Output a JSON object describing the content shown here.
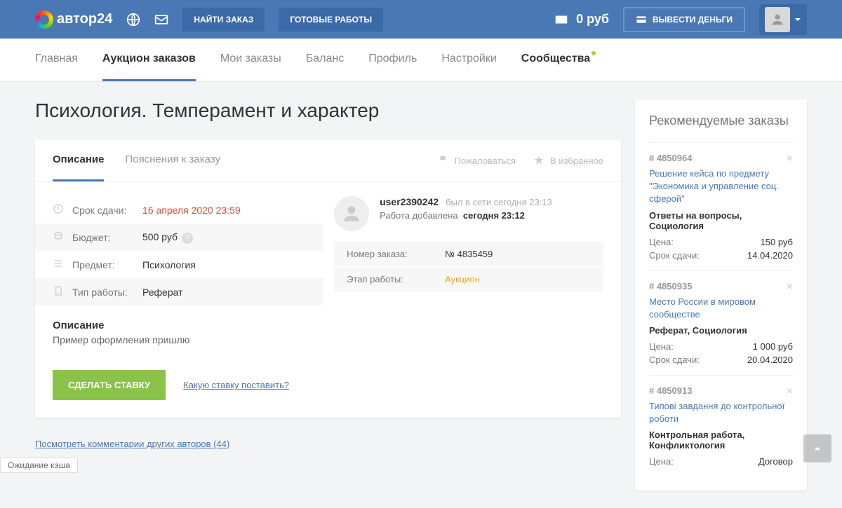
{
  "header": {
    "logo": "автор24",
    "find_order": "НАЙТИ ЗАКАЗ",
    "ready_works": "ГОТОВЫЕ РАБОТЫ",
    "balance": "0 руб",
    "withdraw": "ВЫВЕСТИ ДЕНЬГИ"
  },
  "nav": {
    "main": "Главная",
    "auction": "Аукцион заказов",
    "my_orders": "Мои заказы",
    "balance": "Баланс",
    "profile": "Профиль",
    "settings": "Настройки",
    "communities": "Сообщества"
  },
  "page_title": "Психология. Темперамент и характер",
  "tabs": {
    "description": "Описание",
    "clarifications": "Пояснения к заказу",
    "complain": "Пожаловаться",
    "favorite": "В избранное"
  },
  "details": {
    "deadline_label": "Срок сдачи:",
    "deadline_value": "16 апреля 2020 23:59",
    "budget_label": "Бюджет:",
    "budget_value": "500 руб",
    "subject_label": "Предмет:",
    "subject_value": "Психология",
    "type_label": "Тип работы:",
    "type_value": "Реферат"
  },
  "author": {
    "name": "user2390242",
    "status": "был в сети сегодня 23:13",
    "added_label": "Работа добавлена",
    "added_value": "сегодня 23:12"
  },
  "order_meta": {
    "number_label": "Номер заказа:",
    "number_value": "№ 4835459",
    "stage_label": "Этап работы:",
    "stage_value": "Аукцион"
  },
  "description": {
    "heading": "Описание",
    "text": "Пример оформления пришлю"
  },
  "actions": {
    "bid": "СДЕЛАТЬ СТАВКУ",
    "help": "Какую ставку поставить?"
  },
  "comments_link": "Посмотреть комментарии других авторов (44)",
  "sidebar": {
    "title": "Рекомендуемые заказы",
    "items": [
      {
        "id": "# 4850964",
        "title": "Решение кейса по предмету \"Экономика и управление соц. сферой\"",
        "type": "Ответы на вопросы, Социология",
        "price_label": "Цена:",
        "price": "150 руб",
        "deadline_label": "Срок сдачи:",
        "deadline": "14.04.2020"
      },
      {
        "id": "# 4850935",
        "title": "Место России в мировом сообществе",
        "type": "Реферат, Социология",
        "price_label": "Цена:",
        "price": "1 000 руб",
        "deadline_label": "Срок сдачи:",
        "deadline": "20.04.2020"
      },
      {
        "id": "# 4850913",
        "title": "Типові завдання до контрольної роботи",
        "type": "Контрольная работа, Конфликтология",
        "price_label": "Цена:",
        "price": "Договор"
      }
    ]
  },
  "status_bar": "Ожидание кэша"
}
